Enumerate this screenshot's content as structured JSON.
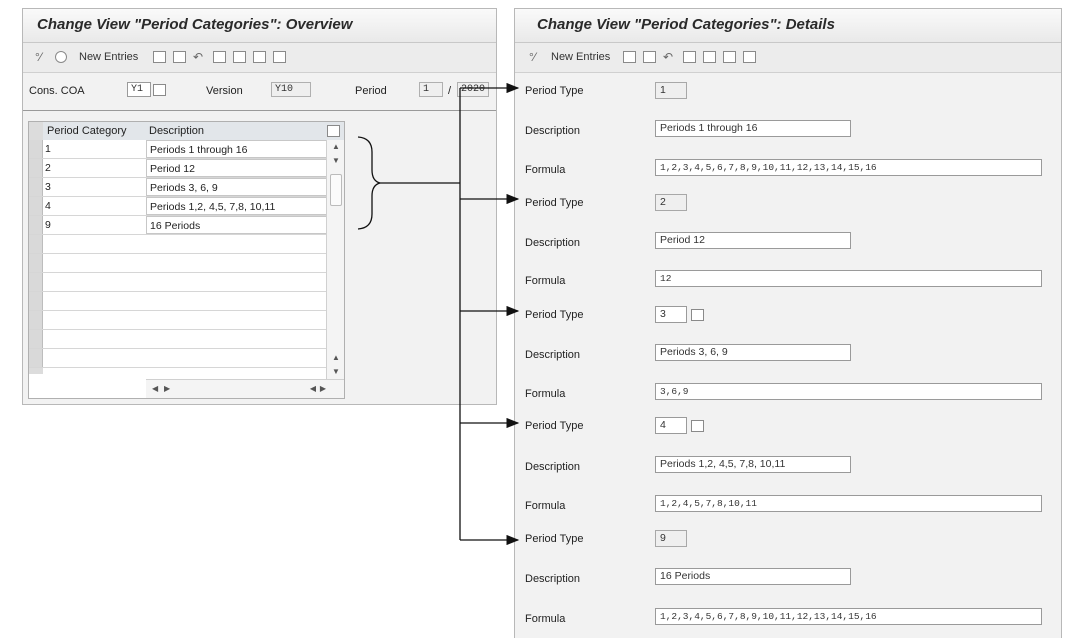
{
  "overview": {
    "title": "Change View \"Period Categories\": Overview",
    "toolbar": {
      "new_entries": "New Entries"
    },
    "cons_coa_label": "Cons. COA",
    "cons_coa_value": "Y1",
    "version_label": "Version",
    "version_value": "Y10",
    "period_label": "Period",
    "period_value": "1",
    "period_sep": "/",
    "year_value": "2020",
    "table": {
      "columns": [
        "Period Category",
        "Description"
      ],
      "rows": [
        {
          "category": "1",
          "description": "Periods 1 through 16"
        },
        {
          "category": "2",
          "description": "Period 12"
        },
        {
          "category": "3",
          "description": "Periods 3, 6, 9"
        },
        {
          "category": "4",
          "description": "Periods 1,2, 4,5, 7,8, 10,11"
        },
        {
          "category": "9",
          "description": "16 Periods"
        }
      ]
    }
  },
  "details": {
    "title": "Change View \"Period Categories\": Details",
    "toolbar": {
      "new_entries": "New Entries"
    },
    "labels": {
      "period_type": "Period Type",
      "description": "Description",
      "formula": "Formula"
    },
    "records": [
      {
        "period_type": "1",
        "description": "Periods 1 through 16",
        "formula": "1,2,3,4,5,6,7,8,9,10,11,12,13,14,15,16"
      },
      {
        "period_type": "2",
        "description": "Period 12",
        "formula": "12"
      },
      {
        "period_type": "3",
        "description": "Periods 3, 6, 9",
        "formula": "3,6,9"
      },
      {
        "period_type": "4",
        "description": "Periods 1,2, 4,5, 7,8, 10,11",
        "formula": "1,2,4,5,7,8,10,11"
      },
      {
        "period_type": "9",
        "description": "16 Periods",
        "formula": "1,2,3,4,5,6,7,8,9,10,11,12,13,14,15,16"
      }
    ]
  },
  "icons": [
    "glasses-icon",
    "display-icon",
    "copy-icon",
    "delete-icon",
    "undo-icon",
    "select-all-icon",
    "deselect-icon",
    "block-icon",
    "details-icon",
    "value-help-icon"
  ]
}
